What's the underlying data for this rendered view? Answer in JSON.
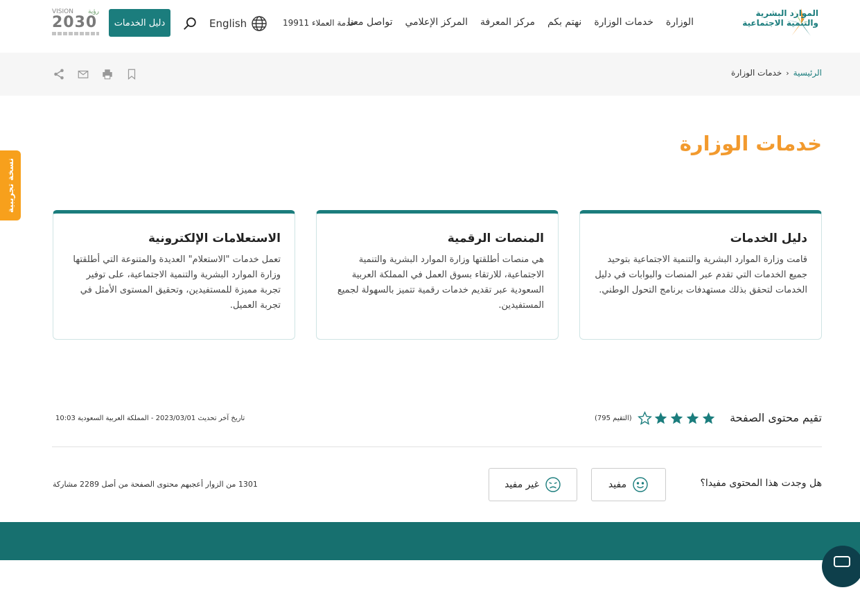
{
  "header": {
    "logo_line1": "الموارد البشرية",
    "logo_line2": "والتنمية الاجتماعية",
    "nav": [
      "الوزارة",
      "خدمات الوزارة",
      "نهتم بكم",
      "مركز المعرفة",
      "المركز الإعلامي",
      "تواصل معنا"
    ],
    "hotline": "خدمة العملاء 19911",
    "language": "English",
    "guide_button": "دليل الخدمات",
    "vision_text": "VISION",
    "vision_year": "2030",
    "vision_arabic": "رؤية",
    "colors": {
      "primary": "#1b7d7d",
      "accent": "#f29a2e",
      "tab": "#f7a01c"
    }
  },
  "breadcrumb": {
    "home": "الرئيسية",
    "separator": "›",
    "current": "خدمات الوزارة"
  },
  "tools": [
    "share-icon",
    "mail-icon",
    "print-icon",
    "bookmark-icon"
  ],
  "side_tab": "نسخة تجريبية",
  "page_title": "خدمات الوزارة",
  "cards": [
    {
      "title": "دليل الخدمات",
      "text": "قامت وزارة الموارد البشرية والتنمية الاجتماعية بتوحيد جميع الخدمات التي تقدم عبر المنصات والبوابات في دليل الخدمات لتحقق بذلك مستهدفات برنامج التحول الوطني."
    },
    {
      "title": "المنصات الرقمية",
      "text": "هي منصات أطلقتها وزارة الموارد البشرية والتنمية الاجتماعية، للارتقاء بسوق العمل في المملكة العربية السعودية عبر تقديم خدمات رقمية تتميز بالسهولة لجميع المستفيدين."
    },
    {
      "title": "الاستعلامات الإلكترونية",
      "text": "تعمل خدمات \"الاستعلام\" العديدة والمتنوعة التي أطلقتها وزارة الموارد البشرية والتنمية الاجتماعية، على توفير تجربة مميزة للمستفيدين، وتحقيق المستوى الأمثل في تجربة العميل."
    }
  ],
  "rating": {
    "label": "تقيم محتوى الصفحة",
    "stars_filled": 4,
    "stars_total": 5,
    "count": "(التقيم 795)"
  },
  "update": {
    "label": "تاريخ آخر تحديث",
    "date": "2023/03/01",
    "separator": "-",
    "location": "المملكة العربية السعودية",
    "time": "10:03"
  },
  "feedback": {
    "question": "هل وجدت هذا المحتوى مفيدا؟",
    "useful": "مفيد",
    "not_useful": "غير مفيد",
    "stats": "1301 من الزوار أعجبهم محتوى الصفحة من أصل 2289 مشاركة"
  }
}
